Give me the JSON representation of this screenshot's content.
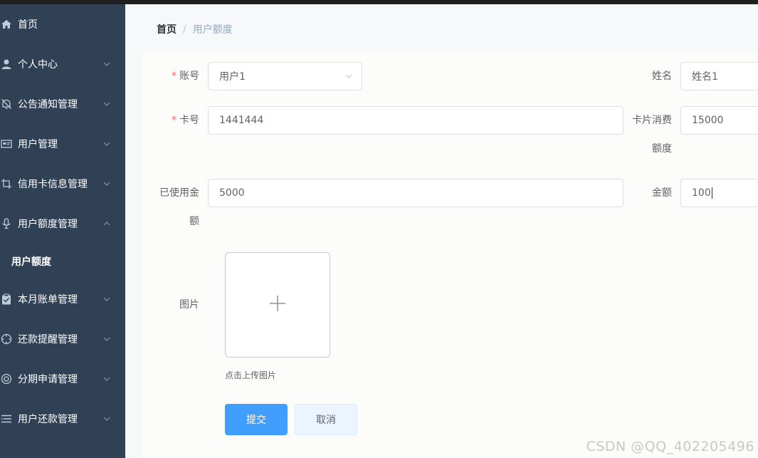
{
  "sidebar": {
    "items": [
      {
        "label": "首页",
        "icon": "home-icon",
        "has_arrow": false
      },
      {
        "label": "个人中心",
        "icon": "user-icon",
        "has_arrow": true
      },
      {
        "label": "公告通知管理",
        "icon": "bell-off-icon",
        "has_arrow": true
      },
      {
        "label": "用户管理",
        "icon": "id-card-icon",
        "has_arrow": true
      },
      {
        "label": "信用卡信息管理",
        "icon": "crop-icon",
        "has_arrow": true
      },
      {
        "label": "用户额度管理",
        "icon": "microphone-icon",
        "has_arrow": true,
        "expanded": true
      },
      {
        "label": "本月账单管理",
        "icon": "clipboard-check-icon",
        "has_arrow": true
      },
      {
        "label": "还款提醒管理",
        "icon": "compass-icon",
        "has_arrow": true
      },
      {
        "label": "分期申请管理",
        "icon": "lifebuoy-icon",
        "has_arrow": true
      },
      {
        "label": "用户还款管理",
        "icon": "list-icon",
        "has_arrow": true
      }
    ],
    "submenu": {
      "label": "用户额度"
    }
  },
  "breadcrumb": {
    "home": "首页",
    "separator": "/",
    "current": "用户额度"
  },
  "form": {
    "account": {
      "label": "账号",
      "value": "用户1"
    },
    "name": {
      "label": "姓名",
      "value": "姓名1"
    },
    "card_no": {
      "label": "卡号",
      "value": "1441444"
    },
    "card_limit": {
      "label_line1": "卡片消费",
      "label_line2": "额度",
      "value": "15000"
    },
    "used_amount": {
      "label_line1": "已使用金",
      "label_line2": "额",
      "value": "5000"
    },
    "amount": {
      "label": "金额",
      "value": "100"
    },
    "image": {
      "label": "图片",
      "tip": "点击上传图片"
    },
    "submit_label": "提交",
    "cancel_label": "取消"
  },
  "watermark": "CSDN @QQ_402205496",
  "colors": {
    "sidebar": "#304156",
    "primary": "#409eff",
    "required": "#f56c6c"
  }
}
